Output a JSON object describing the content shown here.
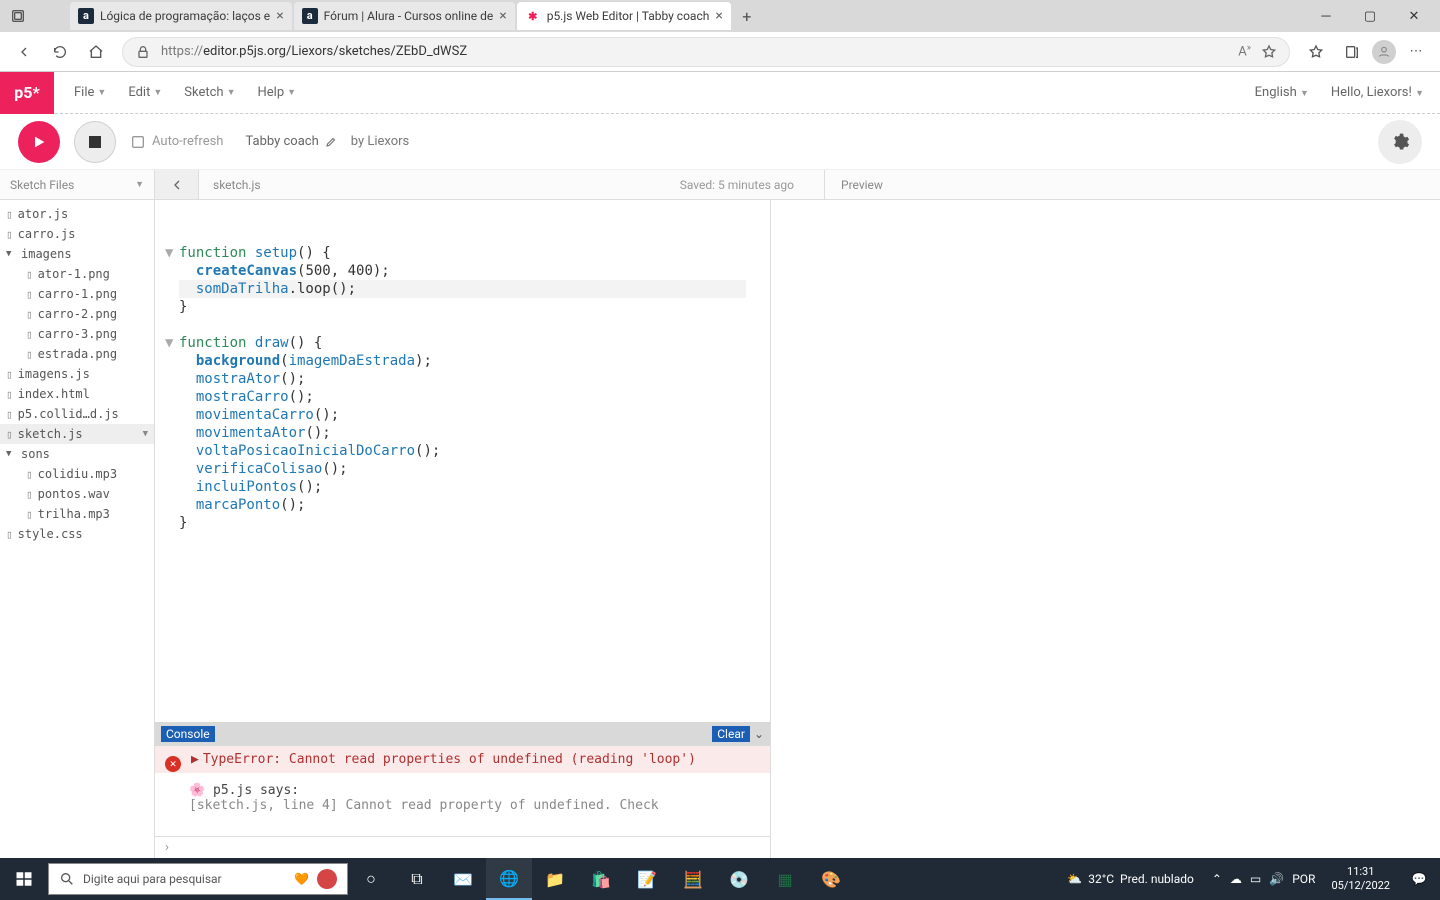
{
  "browser": {
    "tabs": [
      {
        "title": "Lógica de programação: laços e",
        "favicon": "a"
      },
      {
        "title": "Fórum | Alura - Cursos online de",
        "favicon": "a"
      },
      {
        "title": "p5.js Web Editor | Tabby coach",
        "favicon": "p5",
        "active": true
      }
    ],
    "url_proto": "https://",
    "url_rest": "editor.p5js.org/Liexors/sketches/ZEbD_dWSZ"
  },
  "p5": {
    "logo": "p5*",
    "menu": {
      "file": "File",
      "edit": "Edit",
      "sketch": "Sketch",
      "help": "Help"
    },
    "lang": "English",
    "hello": "Hello, Liexors!",
    "auto_refresh": "Auto-refresh",
    "sketch_name": "Tabby coach",
    "by": "by Liexors",
    "sidebar_header": "Sketch Files",
    "code_tab": "sketch.js",
    "saved": "Saved: 5 minutes ago",
    "preview": "Preview"
  },
  "files": [
    {
      "name": "ator.js",
      "type": "file"
    },
    {
      "name": "carro.js",
      "type": "file"
    },
    {
      "name": "imagens",
      "type": "folder"
    },
    {
      "name": "ator-1.png",
      "type": "file",
      "indent": 1
    },
    {
      "name": "carro-1.png",
      "type": "file",
      "indent": 1
    },
    {
      "name": "carro-2.png",
      "type": "file",
      "indent": 1
    },
    {
      "name": "carro-3.png",
      "type": "file",
      "indent": 1
    },
    {
      "name": "estrada.png",
      "type": "file",
      "indent": 1
    },
    {
      "name": "imagens.js",
      "type": "file"
    },
    {
      "name": "index.html",
      "type": "file"
    },
    {
      "name": "p5.collid…d.js",
      "type": "file"
    },
    {
      "name": "sketch.js",
      "type": "file",
      "active": true
    },
    {
      "name": "sons",
      "type": "folder"
    },
    {
      "name": "colidiu.mp3",
      "type": "file",
      "indent": 1
    },
    {
      "name": "pontos.wav",
      "type": "file",
      "indent": 1
    },
    {
      "name": "trilha.mp3",
      "type": "file",
      "indent": 1
    },
    {
      "name": "style.css",
      "type": "file"
    }
  ],
  "code": {
    "l1a": "function ",
    "l1b": "setup",
    "l1c": "() {",
    "l2a": "  ",
    "l2b": "createCanvas",
    "l2c": "(500, 400);",
    "l3a": "  ",
    "l3b": "somDaTrilha",
    "l3c": ".loop();",
    "l4": "}",
    "l5": "",
    "l6a": "function ",
    "l6b": "draw",
    "l6c": "() {",
    "l7a": "  ",
    "l7b": "background",
    "l7c": "(",
    "l7d": "imagemDaEstrada",
    "l7e": ");",
    "l8a": "  ",
    "l8b": "mostraAtor",
    "l8c": "();",
    "l9a": "  ",
    "l9b": "mostraCarro",
    "l9c": "();",
    "l10a": "  ",
    "l10b": "movimentaCarro",
    "l10c": "();",
    "l11a": "  ",
    "l11b": "movimentaAtor",
    "l11c": "();",
    "l12a": "  ",
    "l12b": "voltaPosicaoInicialDoCarro",
    "l12c": "();",
    "l13a": "  ",
    "l13b": "verificaColisao",
    "l13c": "();",
    "l14a": "  ",
    "l14b": "incluiPontos",
    "l14c": "();",
    "l15a": "  ",
    "l15b": "marcaPonto",
    "l15c": "();",
    "l16": "}"
  },
  "console": {
    "label": "Console",
    "clear": "Clear",
    "error": "TypeError: Cannot read properties of undefined (reading 'loop')",
    "says_prefix": "🌸 p5.js says:",
    "says_body": "[sketch.js, line 4] Cannot read property of undefined. Check"
  },
  "taskbar": {
    "search_placeholder": "Digite aqui para pesquisar",
    "weather_temp": "32°C",
    "weather_text": "Pred. nublado",
    "lang": "POR",
    "time": "11:31",
    "date": "05/12/2022"
  }
}
